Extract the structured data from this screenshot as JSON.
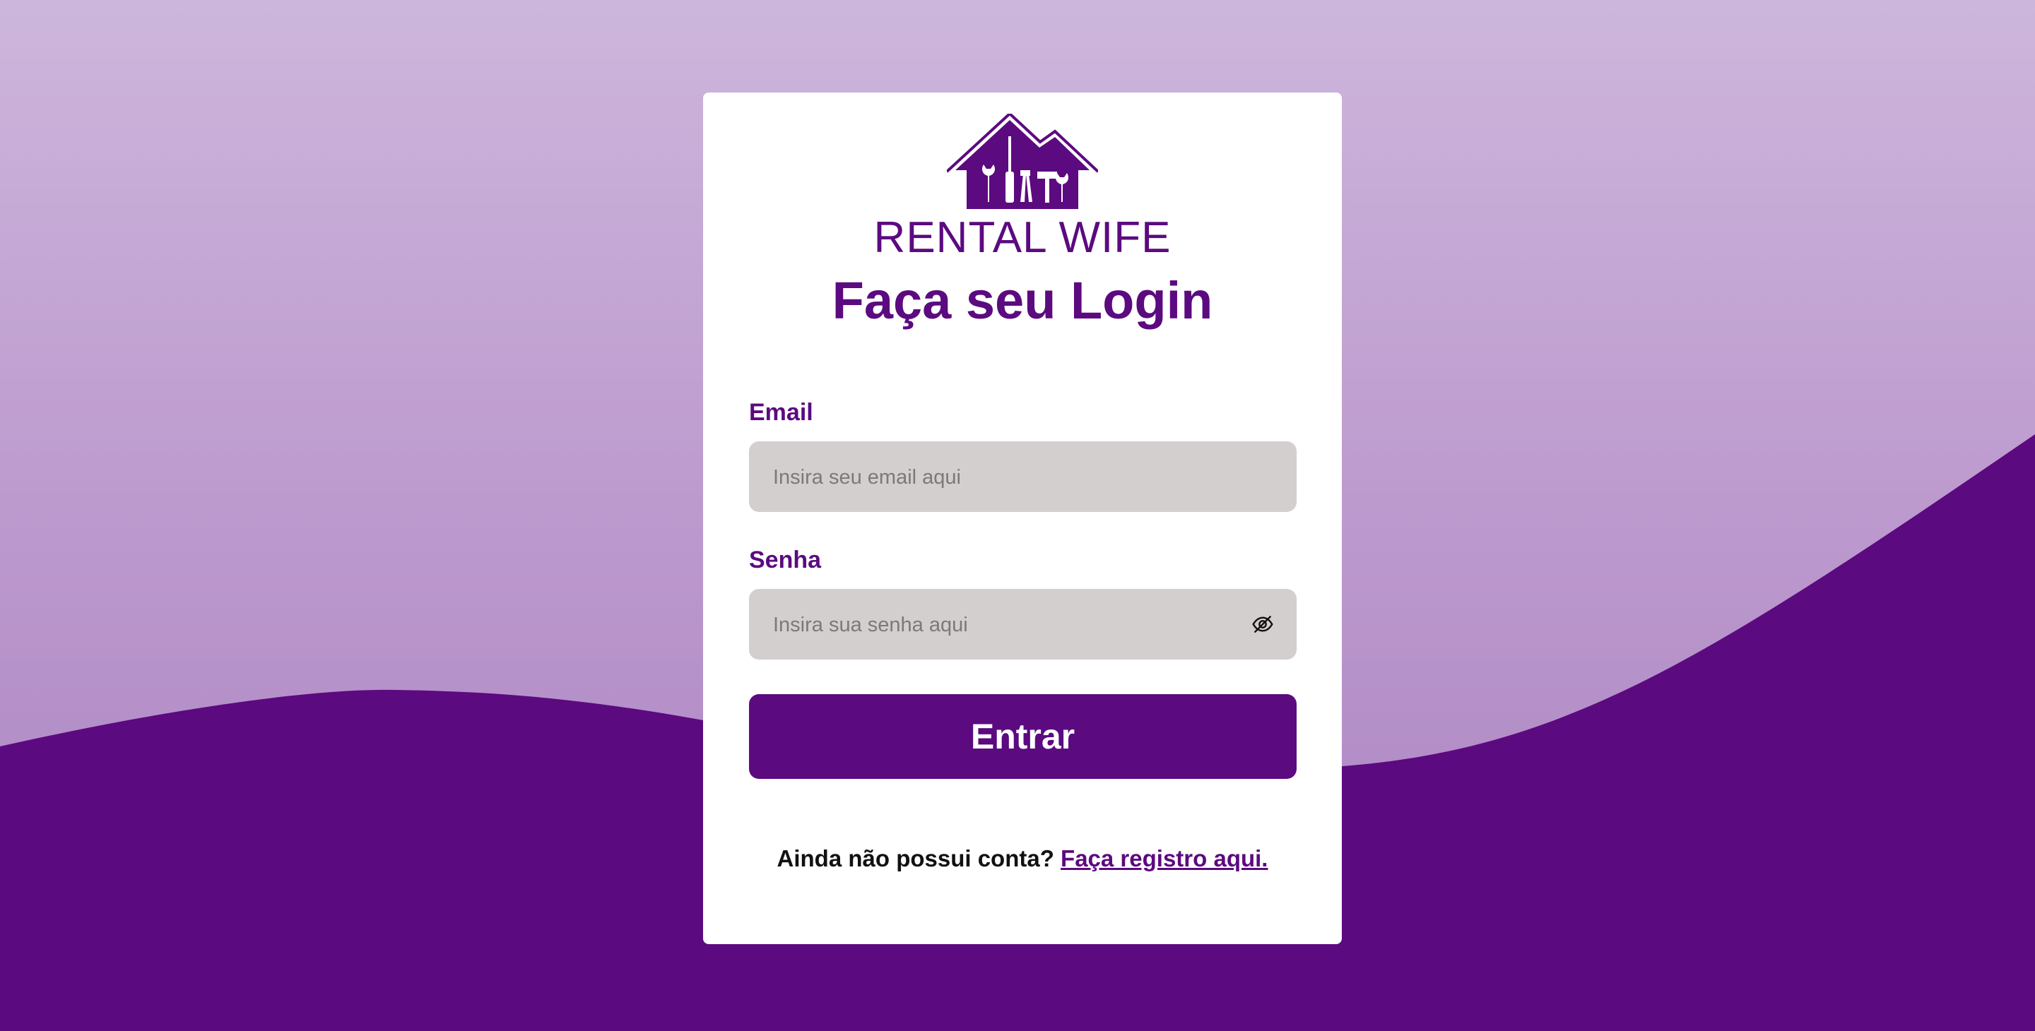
{
  "brand": {
    "name": "RENTAL WIFE",
    "logo_icon": "house-tools-icon"
  },
  "login": {
    "title": "Faça seu Login",
    "email_label": "Email",
    "email_value": "",
    "email_placeholder": "Insira seu email aqui",
    "password_label": "Senha",
    "password_value": "",
    "password_placeholder": "Insira sua senha aqui",
    "password_toggle_icon": "eye-off-icon",
    "submit_label": "Entrar",
    "register_prompt": "Ainda não possui conta?",
    "register_link": "Faça registro aqui."
  },
  "colors": {
    "primary": "#5c0a80",
    "background_top": "#cdb6dc",
    "background_bottom": "#a981c1",
    "input_bg": "#d2cfce",
    "card_bg": "#ffffff"
  }
}
